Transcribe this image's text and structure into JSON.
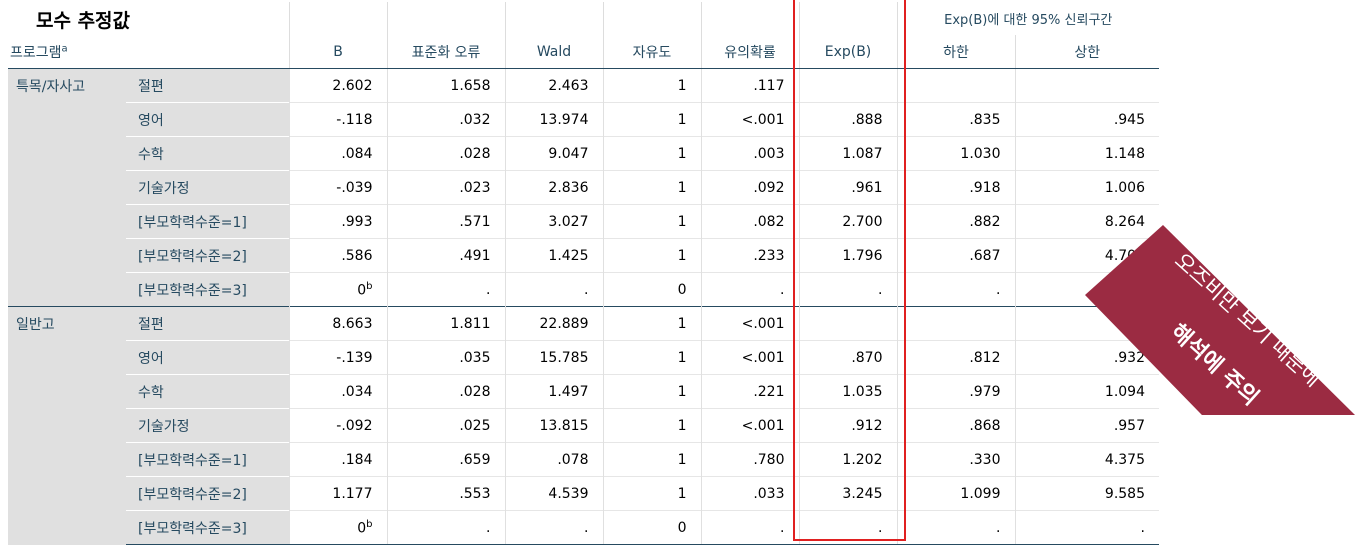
{
  "title": "모수 추정값",
  "header": {
    "program_label": "프로그램",
    "program_sup": "a",
    "ci_group": "Exp(B)에 대한 95% 신뢰구간",
    "columns": [
      "B",
      "표준화 오류",
      "Wald",
      "자유도",
      "유의확률",
      "Exp(B)",
      "하한",
      "상한"
    ]
  },
  "groups": [
    {
      "name": "특목/자사고",
      "rows": [
        {
          "label": "절편",
          "cells": [
            "2.602",
            "1.658",
            "2.463",
            "1",
            ".117",
            "",
            "",
            ""
          ]
        },
        {
          "label": "영어",
          "cells": [
            "-.118",
            ".032",
            "13.974",
            "1",
            "<.001",
            ".888",
            ".835",
            ".945"
          ]
        },
        {
          "label": "수학",
          "cells": [
            ".084",
            ".028",
            "9.047",
            "1",
            ".003",
            "1.087",
            "1.030",
            "1.148"
          ]
        },
        {
          "label": "기술가정",
          "cells": [
            "-.039",
            ".023",
            "2.836",
            "1",
            ".092",
            ".961",
            ".918",
            "1.006"
          ]
        },
        {
          "label": "[부모학력수준=1]",
          "cells": [
            ".993",
            ".571",
            "3.027",
            "1",
            ".082",
            "2.700",
            ".882",
            "8.264"
          ]
        },
        {
          "label": "[부모학력수준=2]",
          "cells": [
            ".586",
            ".491",
            "1.425",
            "1",
            ".233",
            "1.796",
            ".687",
            "4.700"
          ]
        },
        {
          "label": "[부모학력수준=3]",
          "cells": [
            "0",
            ".",
            ".",
            "0",
            ".",
            ".",
            ".",
            "."
          ],
          "sup": "b"
        }
      ]
    },
    {
      "name": "일반고",
      "rows": [
        {
          "label": "절편",
          "cells": [
            "8.663",
            "1.811",
            "22.889",
            "1",
            "<.001",
            "",
            "",
            ""
          ]
        },
        {
          "label": "영어",
          "cells": [
            "-.139",
            ".035",
            "15.785",
            "1",
            "<.001",
            ".870",
            ".812",
            ".932"
          ]
        },
        {
          "label": "수학",
          "cells": [
            ".034",
            ".028",
            "1.497",
            "1",
            ".221",
            "1.035",
            ".979",
            "1.094"
          ]
        },
        {
          "label": "기술가정",
          "cells": [
            "-.092",
            ".025",
            "13.815",
            "1",
            "<.001",
            ".912",
            ".868",
            ".957"
          ]
        },
        {
          "label": "[부모학력수준=1]",
          "cells": [
            ".184",
            ".659",
            ".078",
            "1",
            ".780",
            "1.202",
            ".330",
            "4.375"
          ]
        },
        {
          "label": "[부모학력수준=2]",
          "cells": [
            "1.177",
            ".553",
            "4.539",
            "1",
            ".033",
            "3.245",
            "1.099",
            "9.585"
          ]
        },
        {
          "label": "[부모학력수준=3]",
          "cells": [
            "0",
            ".",
            ".",
            "0",
            ".",
            ".",
            ".",
            "."
          ],
          "sup": "b"
        }
      ]
    }
  ],
  "annotation": {
    "line1": "오즈비만 보기 때문에",
    "line2": "해석에 주의",
    "ribbon_color": "#9b2b42",
    "box_color": "#e02020"
  }
}
